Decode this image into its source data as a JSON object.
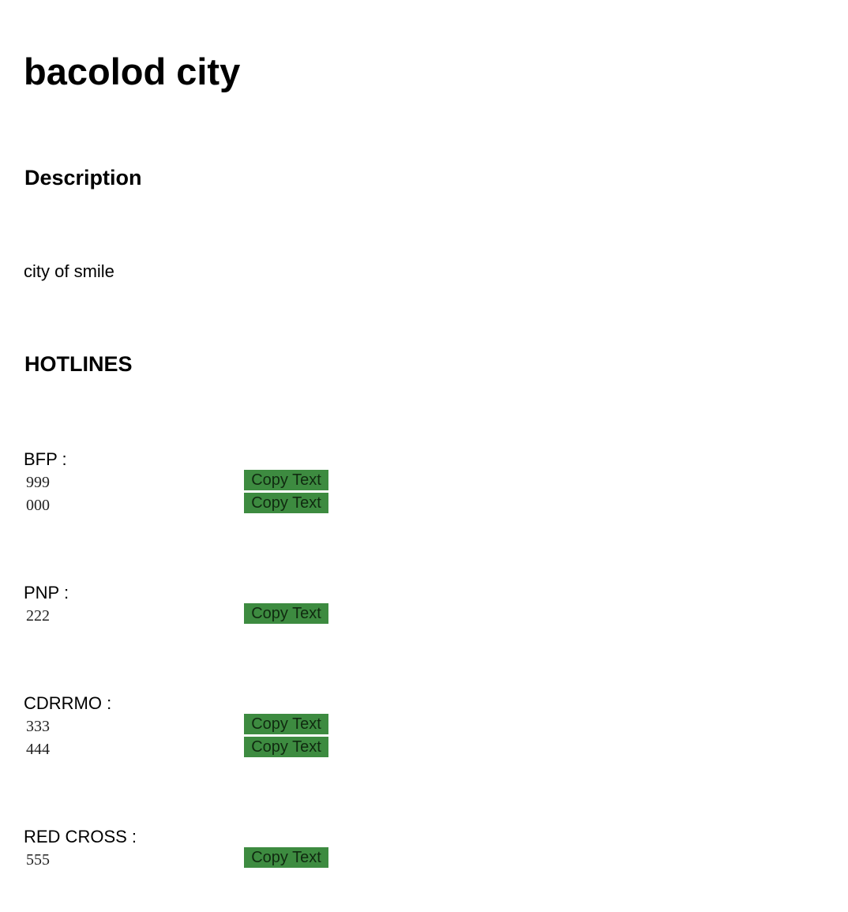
{
  "page": {
    "title": "bacolod city",
    "description_heading": "Description",
    "description": "city of smile",
    "hotlines_heading": "HOTLINES"
  },
  "hotlines": [
    {
      "name": "BFP :",
      "numbers": [
        "999",
        "000"
      ]
    },
    {
      "name": "PNP :",
      "numbers": [
        "222"
      ]
    },
    {
      "name": "CDRRMO :",
      "numbers": [
        "333",
        "444"
      ]
    },
    {
      "name": "RED CROSS :",
      "numbers": [
        "555"
      ]
    }
  ],
  "copy_button_label": "Copy Text",
  "colors": {
    "button_bg": "#3d8b40",
    "button_text": "#102a10"
  }
}
